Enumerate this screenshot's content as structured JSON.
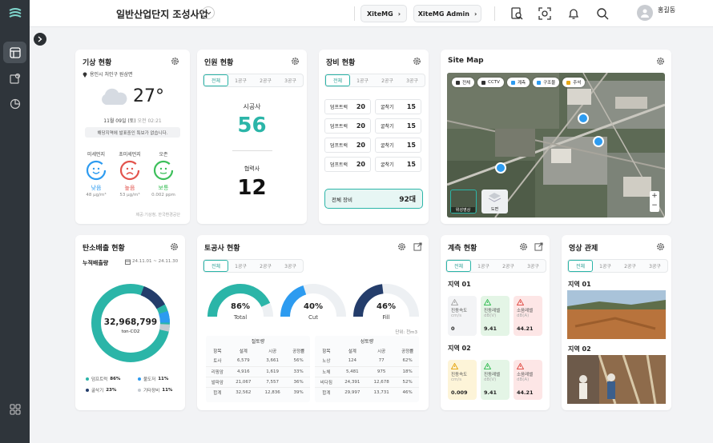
{
  "topbar": {
    "title": "일반산업단지 조성사업",
    "btn1": "XiteMG",
    "btn2": "XiteMG Admin",
    "user": "홍길동"
  },
  "weather": {
    "title": "기상 현황",
    "location": "용인시 처인구 원삼면",
    "temp": "27°",
    "date": "11월 09일 (토)",
    "time": "오전 02:21",
    "notice": "해당지역에 발표중인 특보가 없습니다.",
    "air": [
      {
        "label": "미세먼지",
        "status": "낮음",
        "value": "48 μg/m³",
        "color": "#2d9bf0"
      },
      {
        "label": "초미세먼지",
        "status": "높음",
        "value": "53 μg/m³",
        "color": "#e2534c"
      },
      {
        "label": "오존",
        "status": "보통",
        "value": "0.002 ppm",
        "color": "#3cbf5a"
      }
    ],
    "source": "제공:기상청, 한국환경공단"
  },
  "personnel": {
    "title": "인원 현황",
    "tabs": [
      "전체",
      "1공구",
      "2공구",
      "3공구"
    ],
    "label1": "시공사",
    "value1": "56",
    "label2": "협력사",
    "value2": "12"
  },
  "equipment": {
    "title": "장비 현황",
    "tabs": [
      "전체",
      "1공구",
      "2공구",
      "3공구"
    ],
    "rows": [
      [
        "덤프트럭",
        "20",
        "굴착기",
        "15"
      ],
      [
        "덤프트럭",
        "20",
        "굴착기",
        "15"
      ],
      [
        "덤프트럭",
        "20",
        "굴착기",
        "15"
      ],
      [
        "덤프트럭",
        "20",
        "굴착기",
        "15"
      ]
    ],
    "total_label": "전체 장비",
    "total_value": "92대"
  },
  "sitemap": {
    "title": "Site Map",
    "pills": [
      "전체",
      "CCTV",
      "계측",
      "구조물",
      "주석"
    ],
    "thumb1": "위성영상",
    "thumb2": "도면",
    "zoom_in": "+",
    "zoom_out": "−"
  },
  "carbon": {
    "title": "탄소배출 현황",
    "sub": "누적배출량",
    "range": "24.11.01 ~ 24.11.30",
    "total": "32,968,799",
    "unit": "ton-CO2",
    "legend": [
      {
        "label": "덤프트럭",
        "pct": "86%",
        "color": "#2bb5a8"
      },
      {
        "label": "불도저",
        "pct": "11%",
        "color": "#2d9bf0"
      },
      {
        "label": "굴삭기",
        "pct": "23%",
        "color": "#243d6b"
      },
      {
        "label": "기타장비",
        "pct": "11%",
        "color": "#c5cbd2"
      }
    ]
  },
  "earthwork": {
    "title": "토공사 현황",
    "tabs": [
      "전체",
      "1공구",
      "2공구",
      "3공구"
    ],
    "gauges": [
      {
        "label": "Total",
        "pct": "86%",
        "value": 86,
        "color": "#2bb5a8"
      },
      {
        "label": "Cut",
        "pct": "40%",
        "value": 40,
        "color": "#2d9bf0"
      },
      {
        "label": "Fill",
        "pct": "46%",
        "value": 46,
        "color": "#243d6b"
      }
    ],
    "unit": "단위: 천m3",
    "cut": {
      "title": "절토량",
      "head": [
        "항목",
        "설계",
        "시공",
        "공정률"
      ],
      "rows": [
        [
          "토사",
          "6,579",
          "3,661",
          "56%"
        ],
        [
          "리핑암",
          "4,916",
          "1,619",
          "33%"
        ],
        [
          "발파암",
          "21,067",
          "7,557",
          "36%"
        ],
        [
          "합계",
          "32,562",
          "12,836",
          "39%"
        ]
      ]
    },
    "fill": {
      "title": "성토량",
      "head": [
        "항목",
        "설계",
        "시공",
        "공정률"
      ],
      "rows": [
        [
          "노상",
          "124",
          "77",
          "62%"
        ],
        [
          "노체",
          "5,481",
          "975",
          "18%"
        ],
        [
          "비다짐",
          "24,391",
          "12,678",
          "52%"
        ],
        [
          "합계",
          "29,997",
          "13,731",
          "46%"
        ]
      ]
    }
  },
  "measure": {
    "title": "계측 현황",
    "tabs": [
      "전체",
      "1공구",
      "2공구",
      "3공구"
    ],
    "zones": [
      {
        "name": "지역 01",
        "sensors": [
          {
            "label": "진동속도",
            "unit": "cm/s",
            "value": "0",
            "bg": "#f3f4f6",
            "c": "#aaa"
          },
          {
            "label": "진동레벨",
            "unit": "dB(V)",
            "value": "9.41",
            "bg": "#e4f5e6",
            "c": "#3cbf5a"
          },
          {
            "label": "소음레벨",
            "unit": "dB(A)",
            "value": "44.21",
            "bg": "#fde6e6",
            "c": "#e2534c"
          }
        ]
      },
      {
        "name": "지역 02",
        "sensors": [
          {
            "label": "진동속도",
            "unit": "cm/s",
            "value": "0.009",
            "bg": "#fdf4d8",
            "c": "#e6a817"
          },
          {
            "label": "진동레벨",
            "unit": "dB(V)",
            "value": "9.41",
            "bg": "#e4f5e6",
            "c": "#3cbf5a"
          },
          {
            "label": "소음레벨",
            "unit": "dB(A)",
            "value": "44.21",
            "bg": "#fde6e6",
            "c": "#e2534c"
          }
        ]
      }
    ]
  },
  "video": {
    "title": "영상 관제",
    "tabs": [
      "전체",
      "1공구",
      "2공구",
      "3공구"
    ],
    "zone1": "지역 01",
    "zone2": "지역 02"
  }
}
